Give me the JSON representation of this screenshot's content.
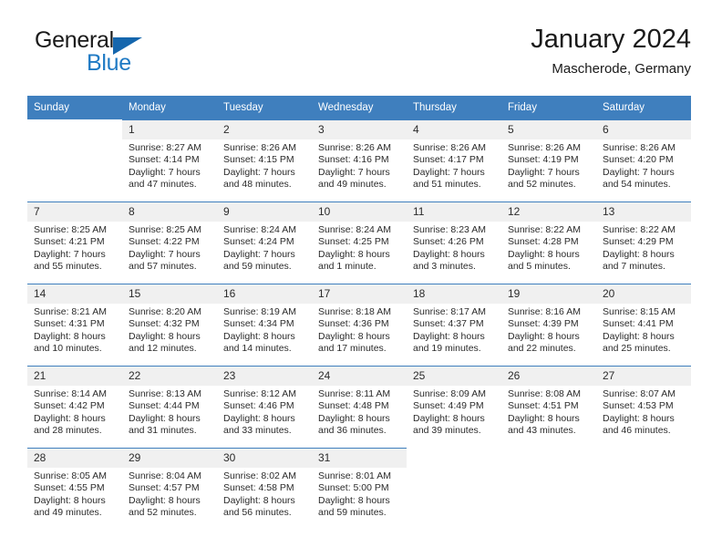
{
  "brand": {
    "name_part1": "General",
    "name_part2": "Blue",
    "logo_icon": "triangle-logo-icon"
  },
  "header": {
    "title": "January 2024",
    "subtitle": "Mascherode, Germany"
  },
  "calendar": {
    "weekday_headers": [
      "Sunday",
      "Monday",
      "Tuesday",
      "Wednesday",
      "Thursday",
      "Friday",
      "Saturday"
    ],
    "accent_color": "#3f7fbe",
    "daynum_band_color": "#f0f0f0",
    "weeks": [
      [
        {
          "day": "",
          "sunrise": "",
          "sunset": "",
          "daylight_line1": "",
          "daylight_line2": ""
        },
        {
          "day": "1",
          "sunrise": "Sunrise: 8:27 AM",
          "sunset": "Sunset: 4:14 PM",
          "daylight_line1": "Daylight: 7 hours",
          "daylight_line2": "and 47 minutes."
        },
        {
          "day": "2",
          "sunrise": "Sunrise: 8:26 AM",
          "sunset": "Sunset: 4:15 PM",
          "daylight_line1": "Daylight: 7 hours",
          "daylight_line2": "and 48 minutes."
        },
        {
          "day": "3",
          "sunrise": "Sunrise: 8:26 AM",
          "sunset": "Sunset: 4:16 PM",
          "daylight_line1": "Daylight: 7 hours",
          "daylight_line2": "and 49 minutes."
        },
        {
          "day": "4",
          "sunrise": "Sunrise: 8:26 AM",
          "sunset": "Sunset: 4:17 PM",
          "daylight_line1": "Daylight: 7 hours",
          "daylight_line2": "and 51 minutes."
        },
        {
          "day": "5",
          "sunrise": "Sunrise: 8:26 AM",
          "sunset": "Sunset: 4:19 PM",
          "daylight_line1": "Daylight: 7 hours",
          "daylight_line2": "and 52 minutes."
        },
        {
          "day": "6",
          "sunrise": "Sunrise: 8:26 AM",
          "sunset": "Sunset: 4:20 PM",
          "daylight_line1": "Daylight: 7 hours",
          "daylight_line2": "and 54 minutes."
        }
      ],
      [
        {
          "day": "7",
          "sunrise": "Sunrise: 8:25 AM",
          "sunset": "Sunset: 4:21 PM",
          "daylight_line1": "Daylight: 7 hours",
          "daylight_line2": "and 55 minutes."
        },
        {
          "day": "8",
          "sunrise": "Sunrise: 8:25 AM",
          "sunset": "Sunset: 4:22 PM",
          "daylight_line1": "Daylight: 7 hours",
          "daylight_line2": "and 57 minutes."
        },
        {
          "day": "9",
          "sunrise": "Sunrise: 8:24 AM",
          "sunset": "Sunset: 4:24 PM",
          "daylight_line1": "Daylight: 7 hours",
          "daylight_line2": "and 59 minutes."
        },
        {
          "day": "10",
          "sunrise": "Sunrise: 8:24 AM",
          "sunset": "Sunset: 4:25 PM",
          "daylight_line1": "Daylight: 8 hours",
          "daylight_line2": "and 1 minute."
        },
        {
          "day": "11",
          "sunrise": "Sunrise: 8:23 AM",
          "sunset": "Sunset: 4:26 PM",
          "daylight_line1": "Daylight: 8 hours",
          "daylight_line2": "and 3 minutes."
        },
        {
          "day": "12",
          "sunrise": "Sunrise: 8:22 AM",
          "sunset": "Sunset: 4:28 PM",
          "daylight_line1": "Daylight: 8 hours",
          "daylight_line2": "and 5 minutes."
        },
        {
          "day": "13",
          "sunrise": "Sunrise: 8:22 AM",
          "sunset": "Sunset: 4:29 PM",
          "daylight_line1": "Daylight: 8 hours",
          "daylight_line2": "and 7 minutes."
        }
      ],
      [
        {
          "day": "14",
          "sunrise": "Sunrise: 8:21 AM",
          "sunset": "Sunset: 4:31 PM",
          "daylight_line1": "Daylight: 8 hours",
          "daylight_line2": "and 10 minutes."
        },
        {
          "day": "15",
          "sunrise": "Sunrise: 8:20 AM",
          "sunset": "Sunset: 4:32 PM",
          "daylight_line1": "Daylight: 8 hours",
          "daylight_line2": "and 12 minutes."
        },
        {
          "day": "16",
          "sunrise": "Sunrise: 8:19 AM",
          "sunset": "Sunset: 4:34 PM",
          "daylight_line1": "Daylight: 8 hours",
          "daylight_line2": "and 14 minutes."
        },
        {
          "day": "17",
          "sunrise": "Sunrise: 8:18 AM",
          "sunset": "Sunset: 4:36 PM",
          "daylight_line1": "Daylight: 8 hours",
          "daylight_line2": "and 17 minutes."
        },
        {
          "day": "18",
          "sunrise": "Sunrise: 8:17 AM",
          "sunset": "Sunset: 4:37 PM",
          "daylight_line1": "Daylight: 8 hours",
          "daylight_line2": "and 19 minutes."
        },
        {
          "day": "19",
          "sunrise": "Sunrise: 8:16 AM",
          "sunset": "Sunset: 4:39 PM",
          "daylight_line1": "Daylight: 8 hours",
          "daylight_line2": "and 22 minutes."
        },
        {
          "day": "20",
          "sunrise": "Sunrise: 8:15 AM",
          "sunset": "Sunset: 4:41 PM",
          "daylight_line1": "Daylight: 8 hours",
          "daylight_line2": "and 25 minutes."
        }
      ],
      [
        {
          "day": "21",
          "sunrise": "Sunrise: 8:14 AM",
          "sunset": "Sunset: 4:42 PM",
          "daylight_line1": "Daylight: 8 hours",
          "daylight_line2": "and 28 minutes."
        },
        {
          "day": "22",
          "sunrise": "Sunrise: 8:13 AM",
          "sunset": "Sunset: 4:44 PM",
          "daylight_line1": "Daylight: 8 hours",
          "daylight_line2": "and 31 minutes."
        },
        {
          "day": "23",
          "sunrise": "Sunrise: 8:12 AM",
          "sunset": "Sunset: 4:46 PM",
          "daylight_line1": "Daylight: 8 hours",
          "daylight_line2": "and 33 minutes."
        },
        {
          "day": "24",
          "sunrise": "Sunrise: 8:11 AM",
          "sunset": "Sunset: 4:48 PM",
          "daylight_line1": "Daylight: 8 hours",
          "daylight_line2": "and 36 minutes."
        },
        {
          "day": "25",
          "sunrise": "Sunrise: 8:09 AM",
          "sunset": "Sunset: 4:49 PM",
          "daylight_line1": "Daylight: 8 hours",
          "daylight_line2": "and 39 minutes."
        },
        {
          "day": "26",
          "sunrise": "Sunrise: 8:08 AM",
          "sunset": "Sunset: 4:51 PM",
          "daylight_line1": "Daylight: 8 hours",
          "daylight_line2": "and 43 minutes."
        },
        {
          "day": "27",
          "sunrise": "Sunrise: 8:07 AM",
          "sunset": "Sunset: 4:53 PM",
          "daylight_line1": "Daylight: 8 hours",
          "daylight_line2": "and 46 minutes."
        }
      ],
      [
        {
          "day": "28",
          "sunrise": "Sunrise: 8:05 AM",
          "sunset": "Sunset: 4:55 PM",
          "daylight_line1": "Daylight: 8 hours",
          "daylight_line2": "and 49 minutes."
        },
        {
          "day": "29",
          "sunrise": "Sunrise: 8:04 AM",
          "sunset": "Sunset: 4:57 PM",
          "daylight_line1": "Daylight: 8 hours",
          "daylight_line2": "and 52 minutes."
        },
        {
          "day": "30",
          "sunrise": "Sunrise: 8:02 AM",
          "sunset": "Sunset: 4:58 PM",
          "daylight_line1": "Daylight: 8 hours",
          "daylight_line2": "and 56 minutes."
        },
        {
          "day": "31",
          "sunrise": "Sunrise: 8:01 AM",
          "sunset": "Sunset: 5:00 PM",
          "daylight_line1": "Daylight: 8 hours",
          "daylight_line2": "and 59 minutes."
        },
        {
          "day": "",
          "sunrise": "",
          "sunset": "",
          "daylight_line1": "",
          "daylight_line2": ""
        },
        {
          "day": "",
          "sunrise": "",
          "sunset": "",
          "daylight_line1": "",
          "daylight_line2": ""
        },
        {
          "day": "",
          "sunrise": "",
          "sunset": "",
          "daylight_line1": "",
          "daylight_line2": ""
        }
      ]
    ]
  }
}
